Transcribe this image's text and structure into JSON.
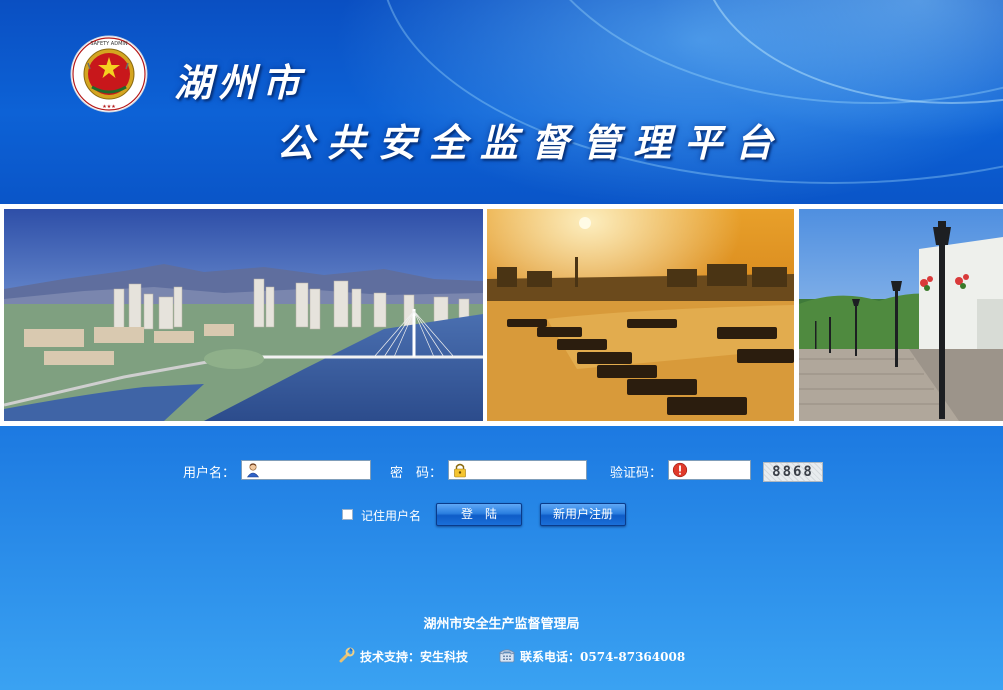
{
  "header": {
    "city": "湖州市",
    "platform": "公共安全监督管理平台",
    "emblem_icon": "safety-administration-emblem-icon"
  },
  "photos": [
    {
      "name": "city-skyline-river-photo"
    },
    {
      "name": "sunset-canal-boats-photo"
    },
    {
      "name": "old-street-lamps-photo"
    }
  ],
  "login": {
    "username_label": "用户名：",
    "password_label": "密　码：",
    "captcha_label": "验证码：",
    "username_value": "",
    "password_value": "",
    "captcha_value": "",
    "captcha_image_text": "8868",
    "remember_label": "记住用户名",
    "login_button": "登　陆",
    "register_button": "新用户注册"
  },
  "footer": {
    "organization": "湖州市安全生产监督管理局",
    "tech_support": "技术支持：安生科技",
    "contact_phone": "联系电话：0574-87364008"
  },
  "colors": {
    "background": "#1772de",
    "header": "#0d62d6",
    "button": "#2b7fe0"
  }
}
